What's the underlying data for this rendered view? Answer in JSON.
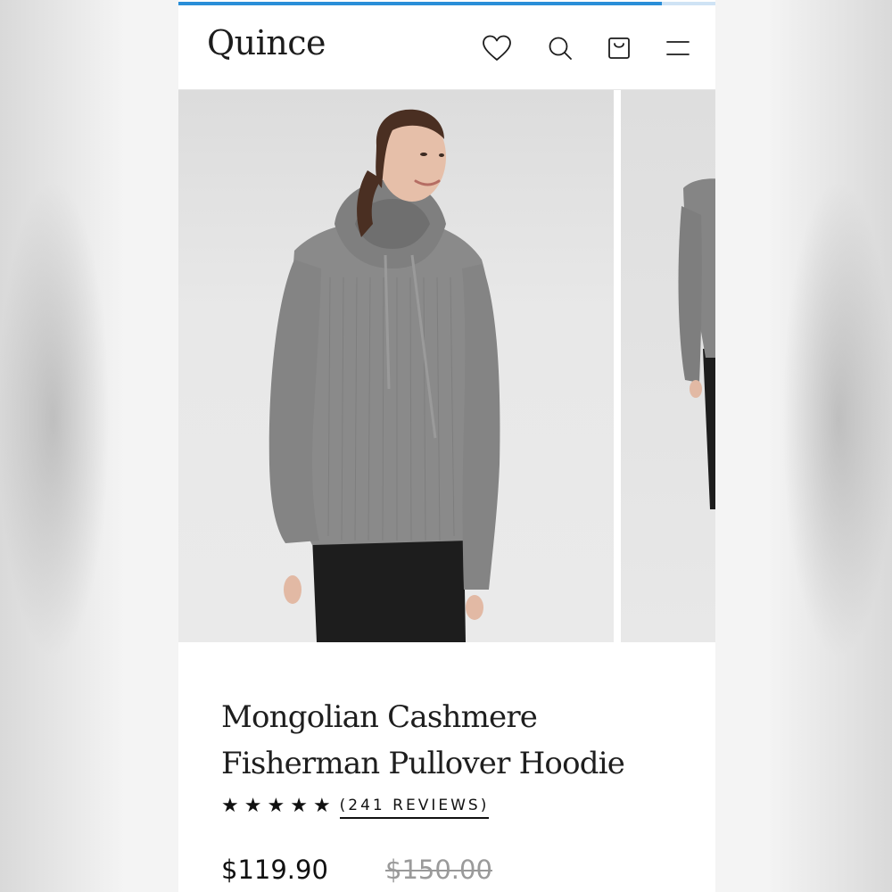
{
  "brand": {
    "logo_text": "Quince"
  },
  "header": {
    "icons": [
      "heart-icon",
      "search-icon",
      "bag-icon",
      "menu-icon"
    ]
  },
  "progress": {
    "fraction": 0.9
  },
  "colors": {
    "accent": "#2a8ed8",
    "sweater": "#8a8a8a",
    "pants": "#1d1d1d",
    "strike_price": "#9a9a9a"
  },
  "product": {
    "title": "Mongolian Cashmere Fisherman Pullover Hoodie",
    "rating_stars": 5,
    "reviews_label": "(241 REVIEWS)",
    "price": "$119.90",
    "compare_price": "$150.00"
  },
  "gallery": {
    "images": [
      "model-front-photo",
      "model-side-photo"
    ]
  }
}
